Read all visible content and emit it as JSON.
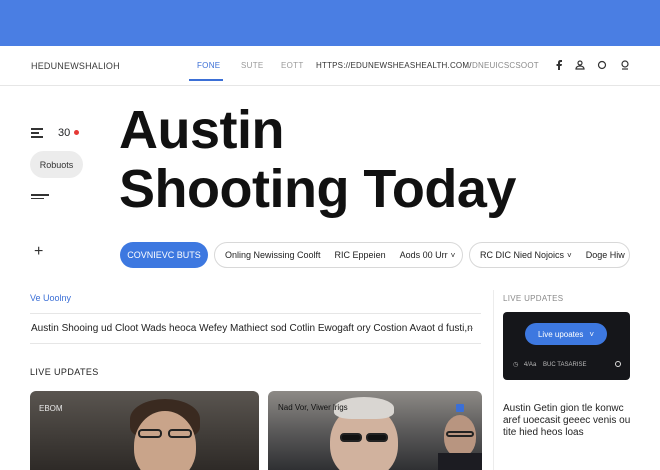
{
  "nav": {
    "brand": "HEDUNEWSHALІOH",
    "links": [
      "FONE",
      "SUTE",
      "EOTT"
    ],
    "active_index": 0,
    "url": "HTTPS://EDUNEWSHEASHEALTH.COM/",
    "url_secondary": "DNEUICSCSOOT",
    "icons": [
      "facebook-icon",
      "user-icon",
      "circle-icon",
      "profile-icon"
    ]
  },
  "left": {
    "count": "30",
    "pill_label": "Robuots",
    "icons": [
      "menu-icon",
      "dash-menu-icon",
      "plus-icon"
    ]
  },
  "headline": {
    "line1": "Austin",
    "line2": "Shooting Today"
  },
  "chips": {
    "primary": "COVNIEVC BUTS",
    "group1": [
      "Onling Newissing Coolft",
      "RIC Eppeien",
      "Aods 00 Urr"
    ],
    "group1_chevron": "˅",
    "group2": [
      "RC DIC Nied Nojoics",
      "Doge Hiw"
    ],
    "group2_chevron": "˅"
  },
  "section": {
    "link": "Ve Uoolny",
    "headline_row": "Austin Shooing ud Cloot Wads heoca Wefey Mathiect sod Cotlin Ewogaft ory Costion Avaot d fusti,n",
    "live_title": "LIVE UPDATES"
  },
  "cards": [
    {
      "caption": "EBOM"
    },
    {
      "caption": "Nad Vor, Viwer lrigs"
    }
  ],
  "right": {
    "label": "LIVE UPDATES",
    "widget_button": "Live upoates",
    "widget_chevron": "˅",
    "widget_meta_a": "4/Аа",
    "widget_meta_b": "BUC TASARISE",
    "story": "Austin Getin gion tle konwc aref uoecasit geeec venis ou tite hied heos loas"
  },
  "colors": {
    "topbar": "#4a7ee3",
    "accent": "#3b6fd6",
    "live_dot": "#e53935",
    "widget_bg": "#15161a"
  }
}
